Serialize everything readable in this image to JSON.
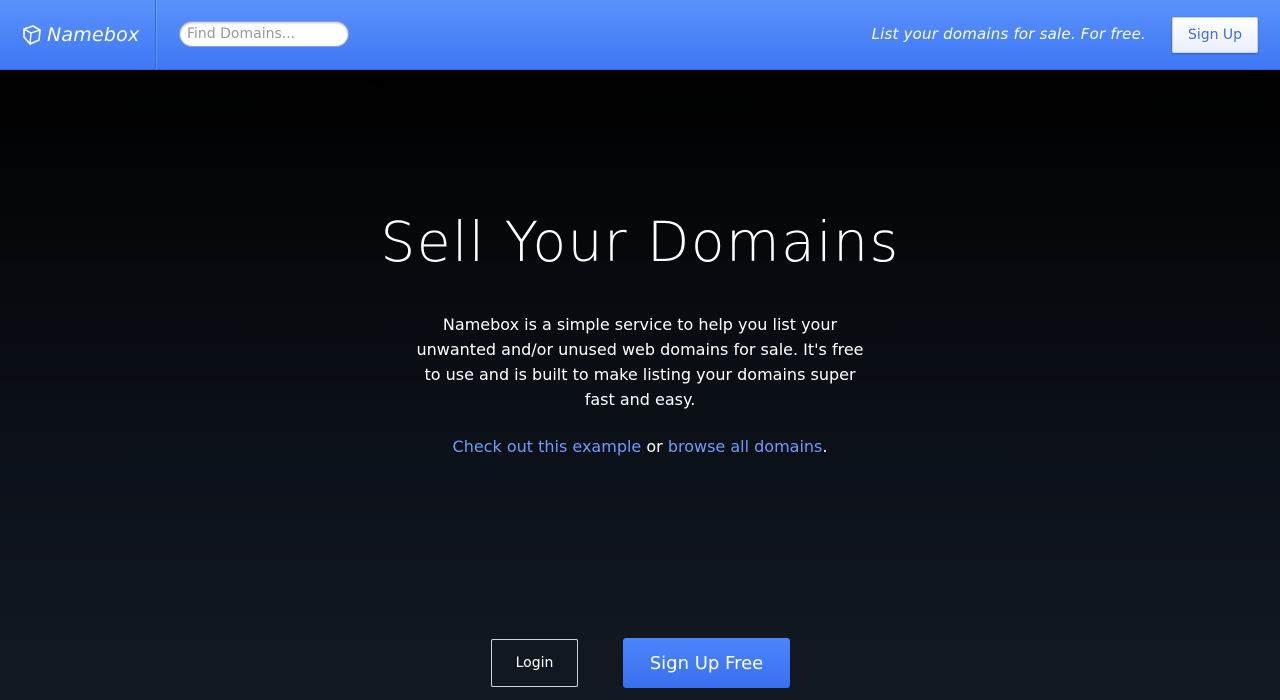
{
  "header": {
    "brand_name": "Namebox",
    "brand_icon": "box-icon",
    "search_placeholder": "Find Domains...",
    "search_value": "",
    "tagline": "List your domains for sale. For free.",
    "signup_label": "Sign Up"
  },
  "hero": {
    "title": "Sell Your Domains",
    "description": "Namebox is a simple service to help you list your unwanted and/or unused web domains for sale. It's free to use and is built to make listing your domains super fast and easy.",
    "example_link": "Check out this example",
    "or_text": " or ",
    "browse_link": "browse all domains",
    "period": "."
  },
  "actions": {
    "login_label": "Login",
    "signup_free_label": "Sign Up Free"
  },
  "colors": {
    "header_blue": "#4a85f8",
    "link_blue": "#6e9bff",
    "cta_blue": "#3f77f5"
  }
}
